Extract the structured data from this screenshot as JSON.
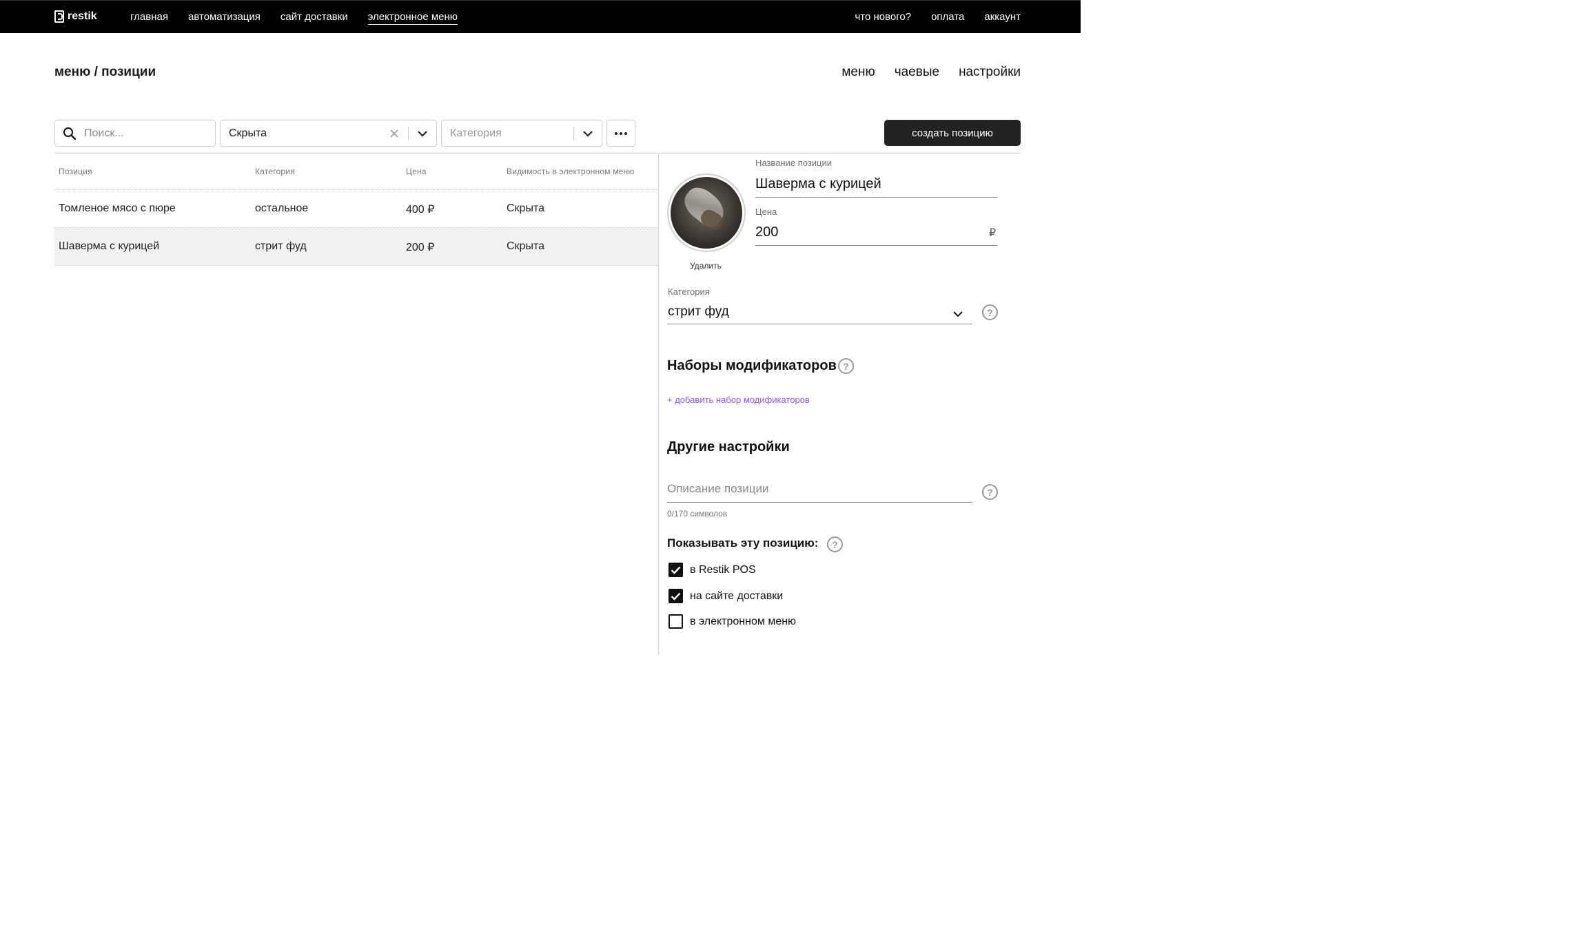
{
  "nav": {
    "logo": "restik",
    "left": [
      "главная",
      "автоматизация",
      "сайт доставки",
      "электронное меню"
    ],
    "right": [
      "что нового?",
      "оплата",
      "аккаунт"
    ]
  },
  "header": {
    "title": "меню / позиции",
    "subnav": [
      "меню",
      "чаевые",
      "настройки"
    ]
  },
  "filters": {
    "search_placeholder": "Поиск...",
    "visibility_value": "Скрыта",
    "category_placeholder": "Категория",
    "create_label": "создать позицию"
  },
  "table": {
    "headers": [
      "Позиция",
      "Категория",
      "Цена",
      "Видимость в электронном меню"
    ],
    "rows": [
      {
        "name": "Томленое мясо с пюре",
        "category": "остальное",
        "price": "400 ₽",
        "visibility": "Скрыта"
      },
      {
        "name": "Шаверма с курицей",
        "category": "стрит фуд",
        "price": "200 ₽",
        "visibility": "Скрыта"
      }
    ]
  },
  "editor": {
    "delete_label": "Удалить",
    "name_label": "Название позиции",
    "name_value": "Шаверма с курицей",
    "price_label": "Цена",
    "price_value": "200",
    "currency": "₽",
    "category_label": "Категория",
    "category_value": "стрит фуд",
    "modifiers_title": "Наборы модификаторов",
    "add_modifiers": "+ добавить набор модификаторов",
    "other_title": "Другие настройки",
    "description_placeholder": "Описание позиции",
    "counter": "0/170 символов",
    "show_title": "Показывать эту позицию:",
    "checks": [
      {
        "label": "в Restik POS",
        "checked": true
      },
      {
        "label": "на сайте доставки",
        "checked": true
      },
      {
        "label": "в электронном меню",
        "checked": false
      }
    ]
  },
  "icons": {
    "help": "question-circle-icon",
    "search": "search-icon",
    "clear": "close-icon",
    "chevron": "chevron-down-icon",
    "more": "more-horizontal-icon"
  }
}
